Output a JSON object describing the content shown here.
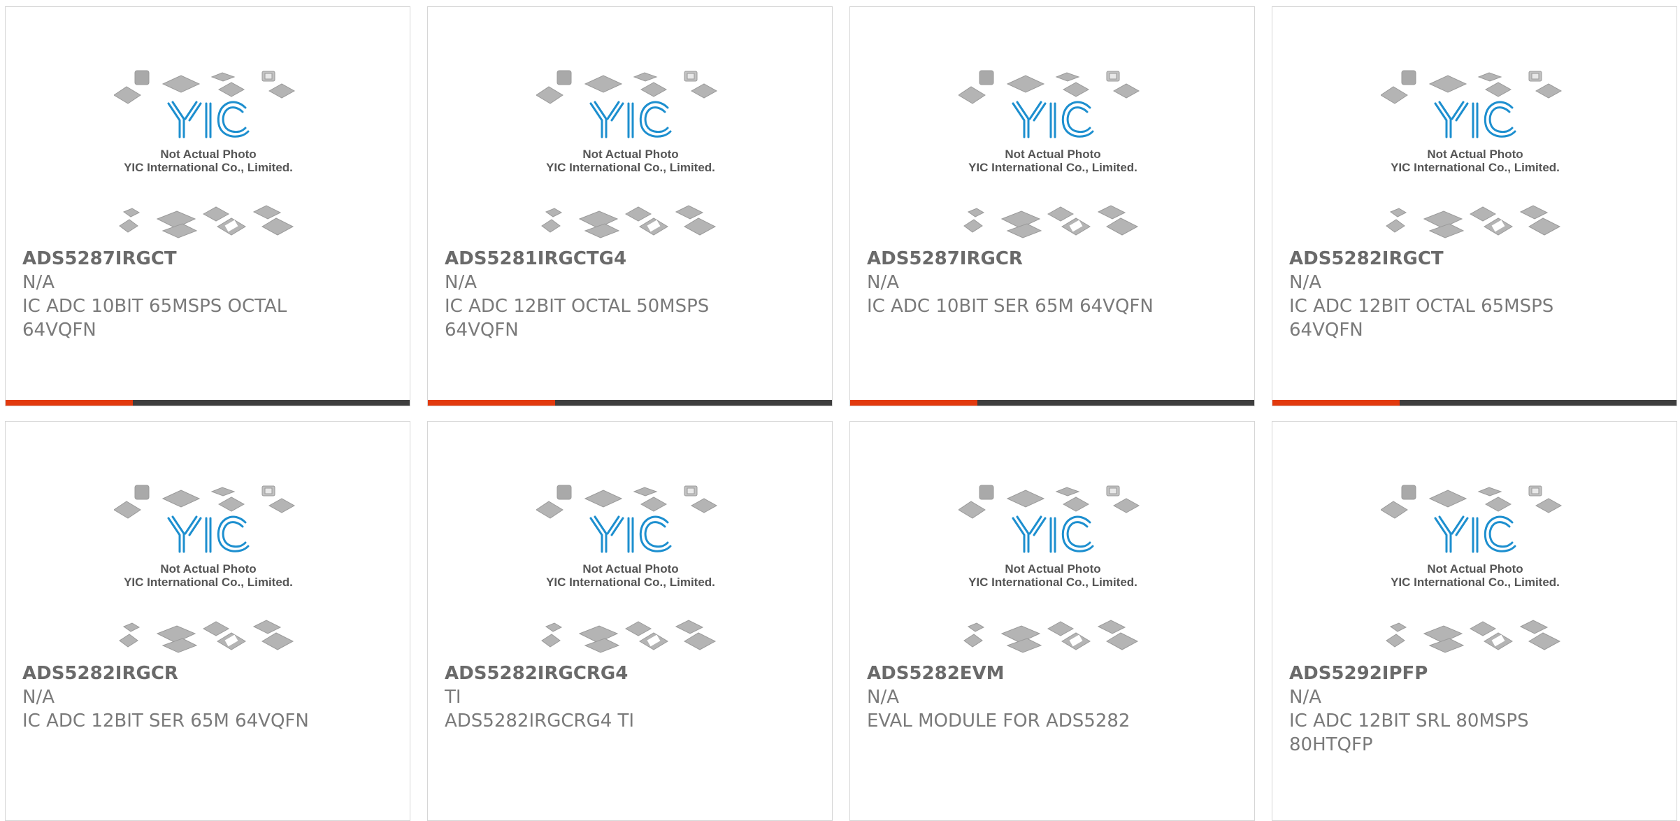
{
  "colors": {
    "accent": "#e23a0e",
    "bar": "#3e3e3e",
    "border": "#d6d6d6",
    "logo_blue": "#1d8fcf",
    "text": "#6a6a6a"
  },
  "placeholder": {
    "caption_line1": "Not Actual Photo",
    "caption_line2": "YIC International Co., Limited.",
    "logo_text": "YIC"
  },
  "products": [
    {
      "part_number": "ADS5287IRGCT",
      "maker": "N/A",
      "description": "IC ADC 10BIT 65MSPS OCTAL 64VQFN"
    },
    {
      "part_number": "ADS5281IRGCTG4",
      "maker": "N/A",
      "description": "IC ADC 12BIT OCTAL 50MSPS 64VQFN"
    },
    {
      "part_number": "ADS5287IRGCR",
      "maker": "N/A",
      "description": "IC ADC 10BIT SER 65M 64VQFN"
    },
    {
      "part_number": "ADS5282IRGCT",
      "maker": "N/A",
      "description": "IC ADC 12BIT OCTAL 65MSPS 64VQFN"
    },
    {
      "part_number": "ADS5282IRGCR",
      "maker": "N/A",
      "description": "IC ADC 12BIT SER 65M 64VQFN"
    },
    {
      "part_number": "ADS5282IRGCRG4",
      "maker": "TI",
      "description": "ADS5282IRGCRG4 TI"
    },
    {
      "part_number": "ADS5282EVM",
      "maker": "N/A",
      "description": "EVAL MODULE FOR ADS5282"
    },
    {
      "part_number": "ADS5292IPFP",
      "maker": "N/A",
      "description": "IC ADC 12BIT SRL 80MSPS 80HTQFP"
    }
  ]
}
